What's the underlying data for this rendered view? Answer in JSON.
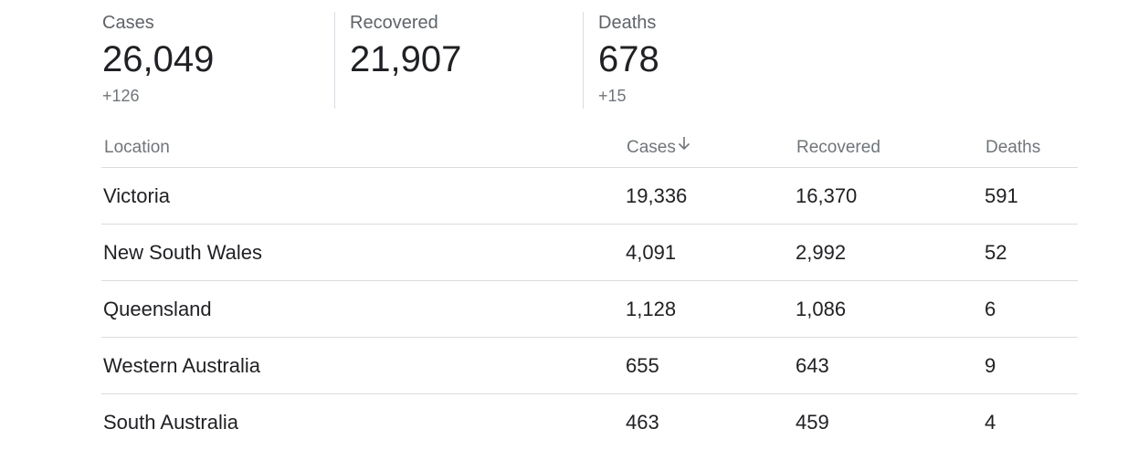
{
  "summary": {
    "cases": {
      "label": "Cases",
      "value": "26,049",
      "delta": "+126"
    },
    "recovered": {
      "label": "Recovered",
      "value": "21,907"
    },
    "deaths": {
      "label": "Deaths",
      "value": "678",
      "delta": "+15"
    }
  },
  "table": {
    "headers": {
      "location": "Location",
      "cases": "Cases",
      "recovered": "Recovered",
      "deaths": "Deaths"
    },
    "sort_icon": "arrow-down-icon",
    "rows": [
      {
        "location": "Victoria",
        "cases": "19,336",
        "recovered": "16,370",
        "deaths": "591"
      },
      {
        "location": "New South Wales",
        "cases": "4,091",
        "recovered": "2,992",
        "deaths": "52"
      },
      {
        "location": "Queensland",
        "cases": "1,128",
        "recovered": "1,086",
        "deaths": "6"
      },
      {
        "location": "Western Australia",
        "cases": "655",
        "recovered": "643",
        "deaths": "9"
      },
      {
        "location": "South Australia",
        "cases": "463",
        "recovered": "459",
        "deaths": "4"
      }
    ]
  },
  "colors": {
    "text_primary": "#202124",
    "text_secondary": "#70757a",
    "divider": "#dadce0"
  }
}
